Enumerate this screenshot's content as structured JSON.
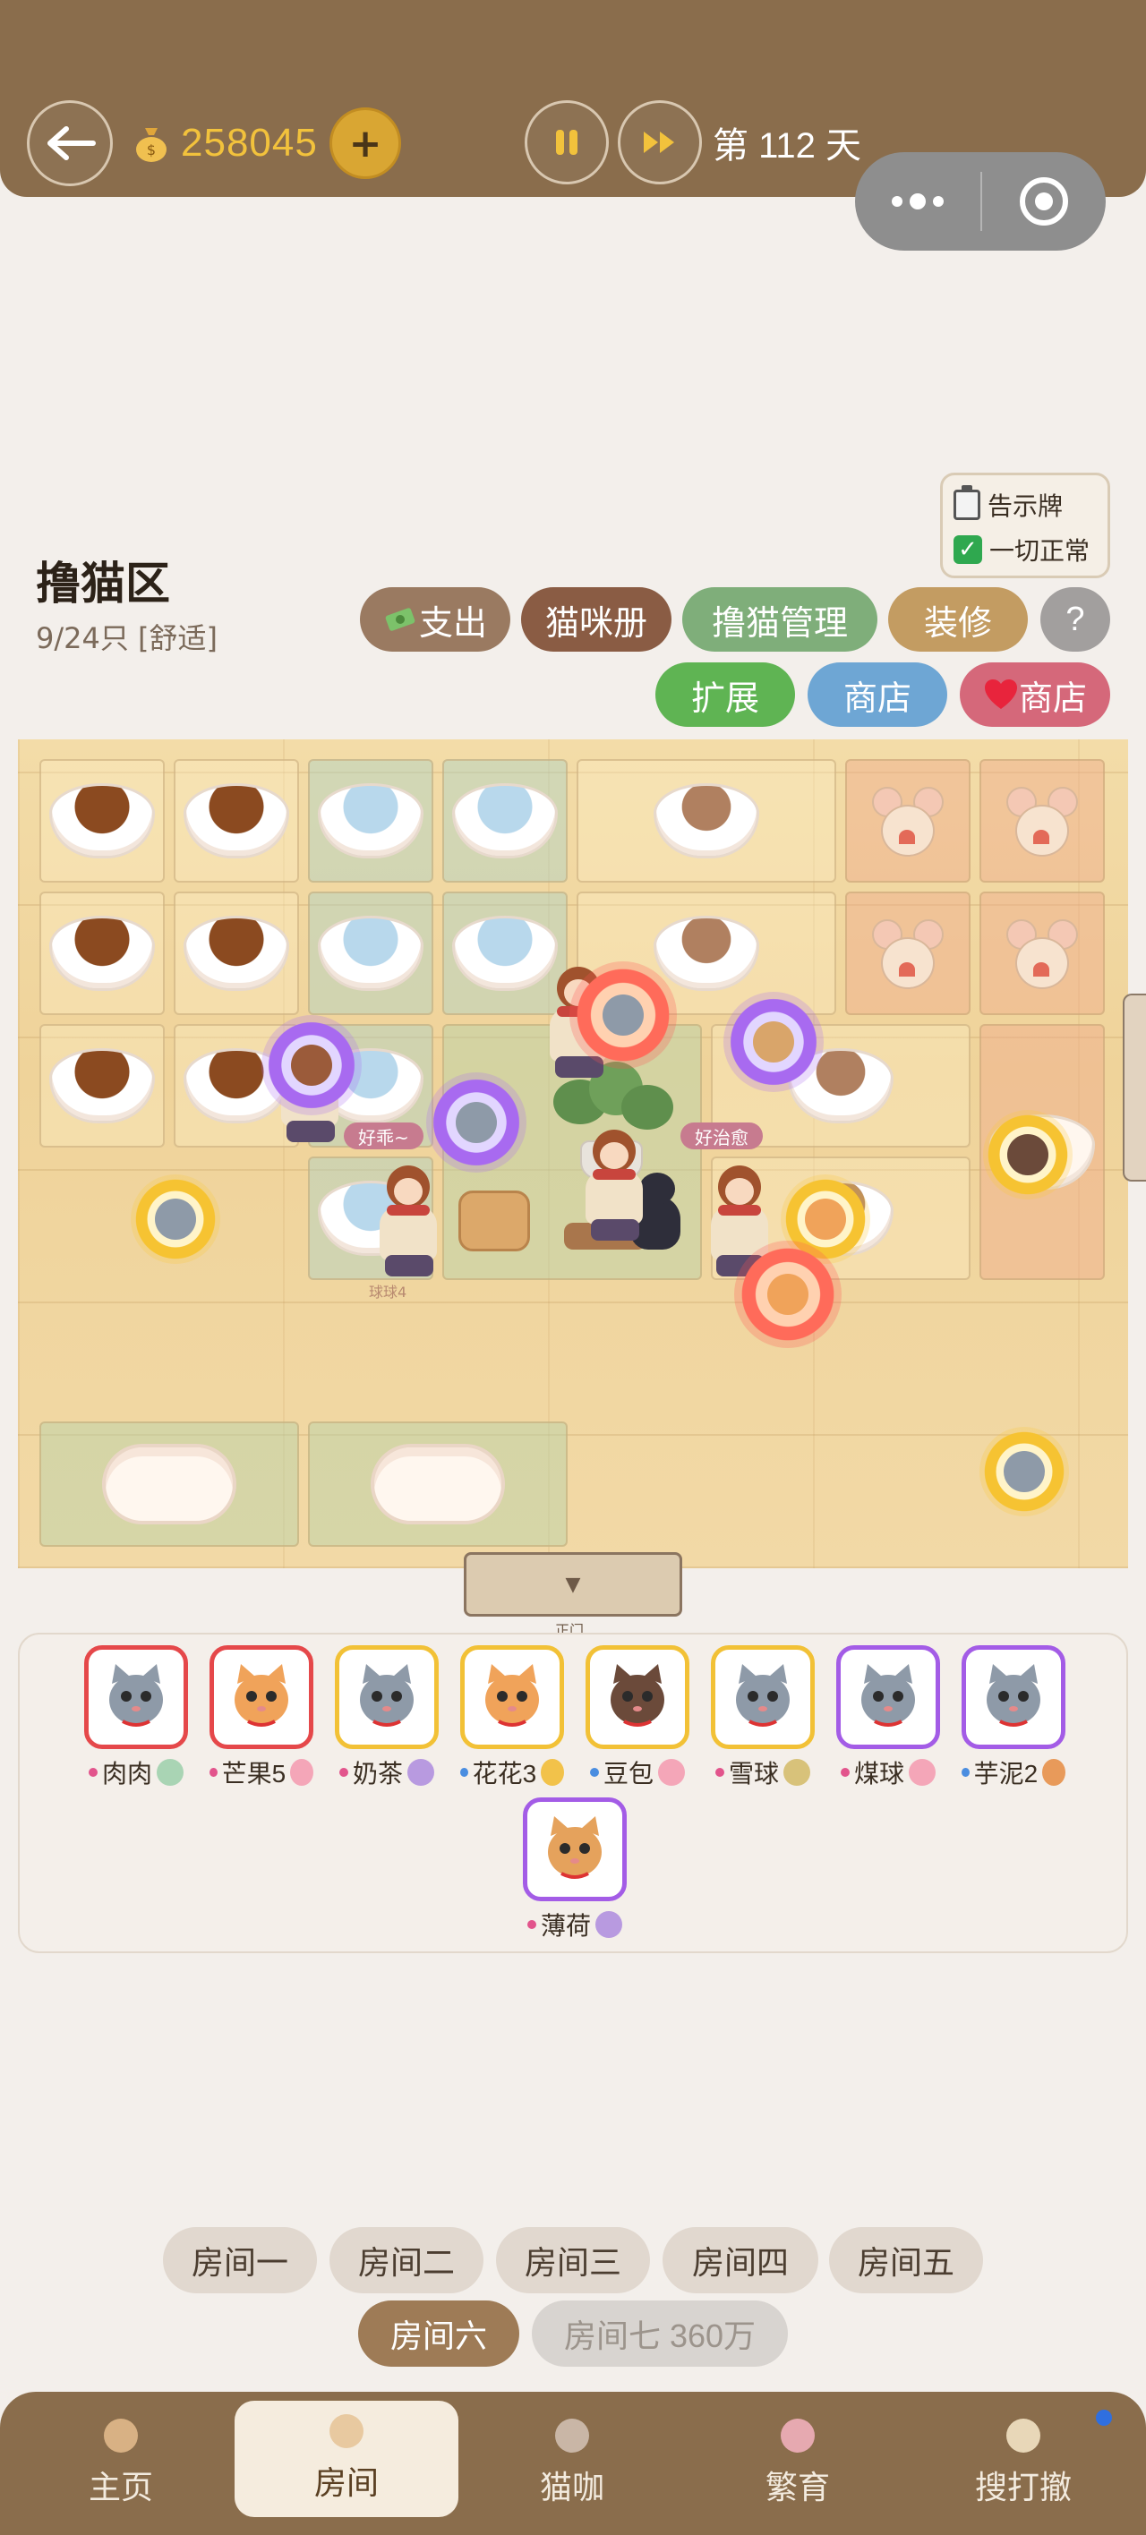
{
  "header": {
    "coins": "258045",
    "add_label": "+",
    "day_label": "第 112 天"
  },
  "notice": {
    "title": "告示牌",
    "status": "一切正常"
  },
  "area": {
    "title": "撸猫区",
    "count": "9/24只 [舒适]"
  },
  "actions": {
    "expense": "支出",
    "catbook": "猫咪册",
    "manage": "撸猫管理",
    "decorate": "装修",
    "help": "?",
    "expand": "扩展",
    "shop": "商店",
    "heart_shop": "商店"
  },
  "floor": {
    "tag_good": "好乖~",
    "tag_heal": "好治愈",
    "label_ball": "球球4",
    "door_arrow": "▼",
    "door_label": "正门"
  },
  "cats": [
    {
      "name": "肉肉",
      "frame": "red",
      "fur": "#8e9aa8",
      "dot": "#e2548c",
      "trait": "#a9d4b4"
    },
    {
      "name": "芒果5",
      "frame": "red",
      "fur": "#f0a35a",
      "dot": "#e2548c",
      "trait": "#f4a6b8"
    },
    {
      "name": "奶茶",
      "frame": "gold",
      "fur": "#8e9aa8",
      "dot": "#e2548c",
      "trait": "#b89ae0"
    },
    {
      "name": "花花3",
      "frame": "gold",
      "fur": "#f0a35a",
      "dot": "#4a8de0",
      "trait": "#f2c24a"
    },
    {
      "name": "豆包",
      "frame": "gold",
      "fur": "#6b4a3a",
      "dot": "#4a8de0",
      "trait": "#f4a6b8"
    },
    {
      "name": "雪球",
      "frame": "gold",
      "fur": "#8e9aa8",
      "dot": "#e2548c",
      "trait": "#d8c27a"
    },
    {
      "name": "煤球",
      "frame": "purple",
      "fur": "#8e9aa8",
      "dot": "#e2548c",
      "trait": "#f4a6b8"
    },
    {
      "name": "芋泥2",
      "frame": "purple",
      "fur": "#8e9aa8",
      "dot": "#4a8de0",
      "trait": "#e89a5a"
    },
    {
      "name": "薄荷",
      "frame": "purple",
      "fur": "#e5a25c",
      "dot": "#e2548c",
      "trait": "#b89ae0"
    }
  ],
  "rooms": [
    {
      "label": "房间一",
      "state": "normal"
    },
    {
      "label": "房间二",
      "state": "normal"
    },
    {
      "label": "房间三",
      "state": "normal"
    },
    {
      "label": "房间四",
      "state": "normal"
    },
    {
      "label": "房间五",
      "state": "normal"
    },
    {
      "label": "房间六",
      "state": "active"
    },
    {
      "label": "房间七 360万",
      "state": "locked"
    }
  ],
  "nav": [
    {
      "label": "主页",
      "icon": "home-icon",
      "color": "#d8b184"
    },
    {
      "label": "房间",
      "icon": "room-icon",
      "color": "#e8c9a0"
    },
    {
      "label": "猫咖",
      "icon": "cafe-icon",
      "color": "#c9b6a6"
    },
    {
      "label": "繁育",
      "icon": "breed-icon",
      "color": "#e6a9b0"
    },
    {
      "label": "搜打撤",
      "icon": "explore-icon",
      "color": "#e8d7b8"
    }
  ],
  "colors": {
    "brand_brown": "#8a6d4c",
    "coin_gold": "#f2c23c",
    "active_room": "#9e7b56"
  }
}
